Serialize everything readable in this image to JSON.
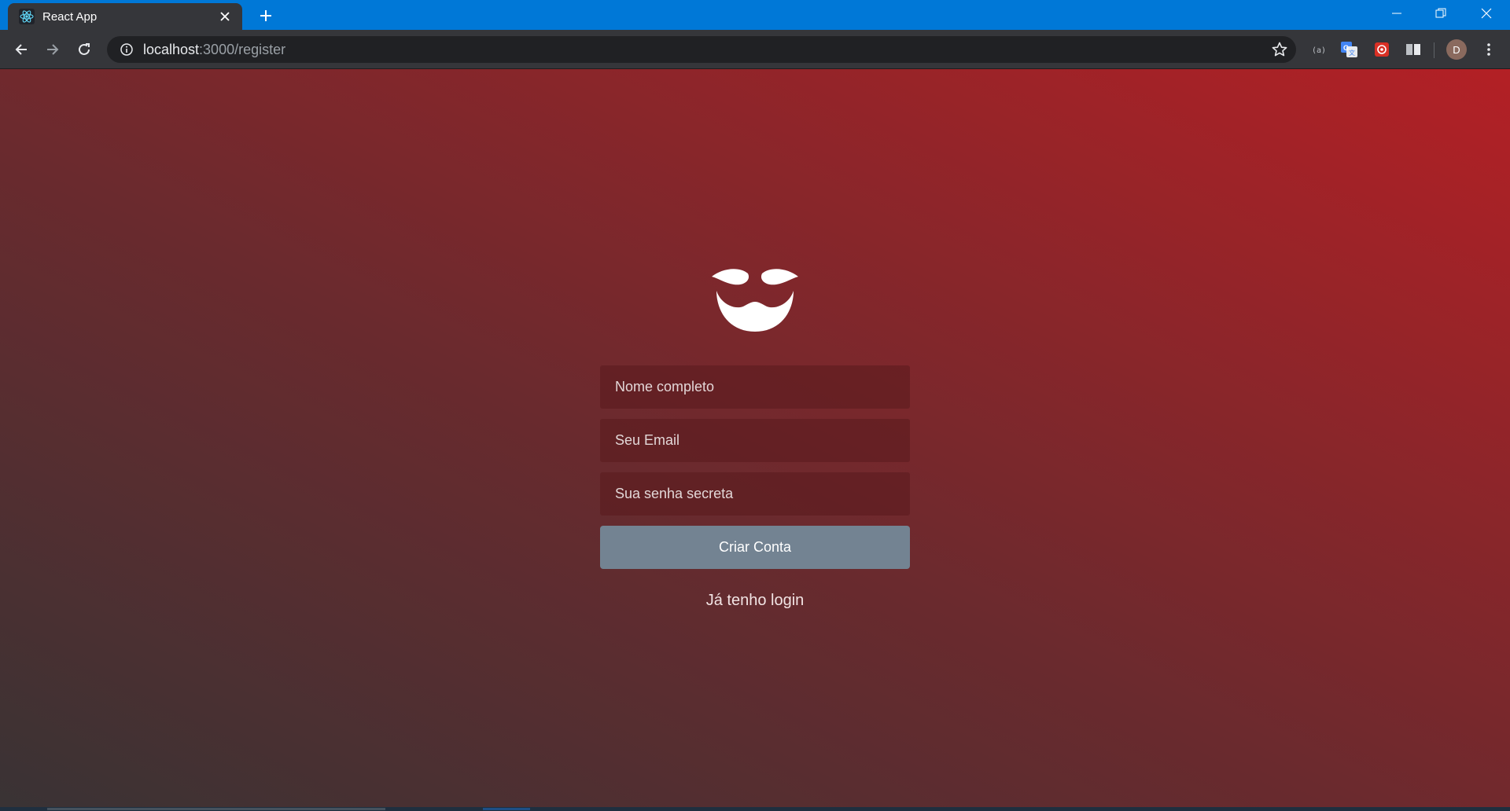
{
  "browser": {
    "tab": {
      "title": "React App",
      "favicon": "react-icon",
      "close": "close-icon"
    },
    "new_tab": "plus-icon",
    "window_controls": [
      "minimize-icon",
      "restore-icon",
      "close-icon"
    ],
    "address": {
      "host": "localhost",
      "path": ":3000/register"
    },
    "profile_initial": "D",
    "extensions": [
      "ext-code-icon",
      "translate-icon",
      "ext-puzzle-icon",
      "reader-icon"
    ]
  },
  "form": {
    "name_placeholder": "Nome completo",
    "email_placeholder": "Seu Email",
    "password_placeholder": "Sua senha secreta",
    "submit_label": "Criar Conta",
    "login_link": "Já tenho login"
  },
  "colors": {
    "gradient_start": "#393334",
    "gradient_end": "#b32025",
    "button": "#738392",
    "titlebar": "#0078d7"
  }
}
